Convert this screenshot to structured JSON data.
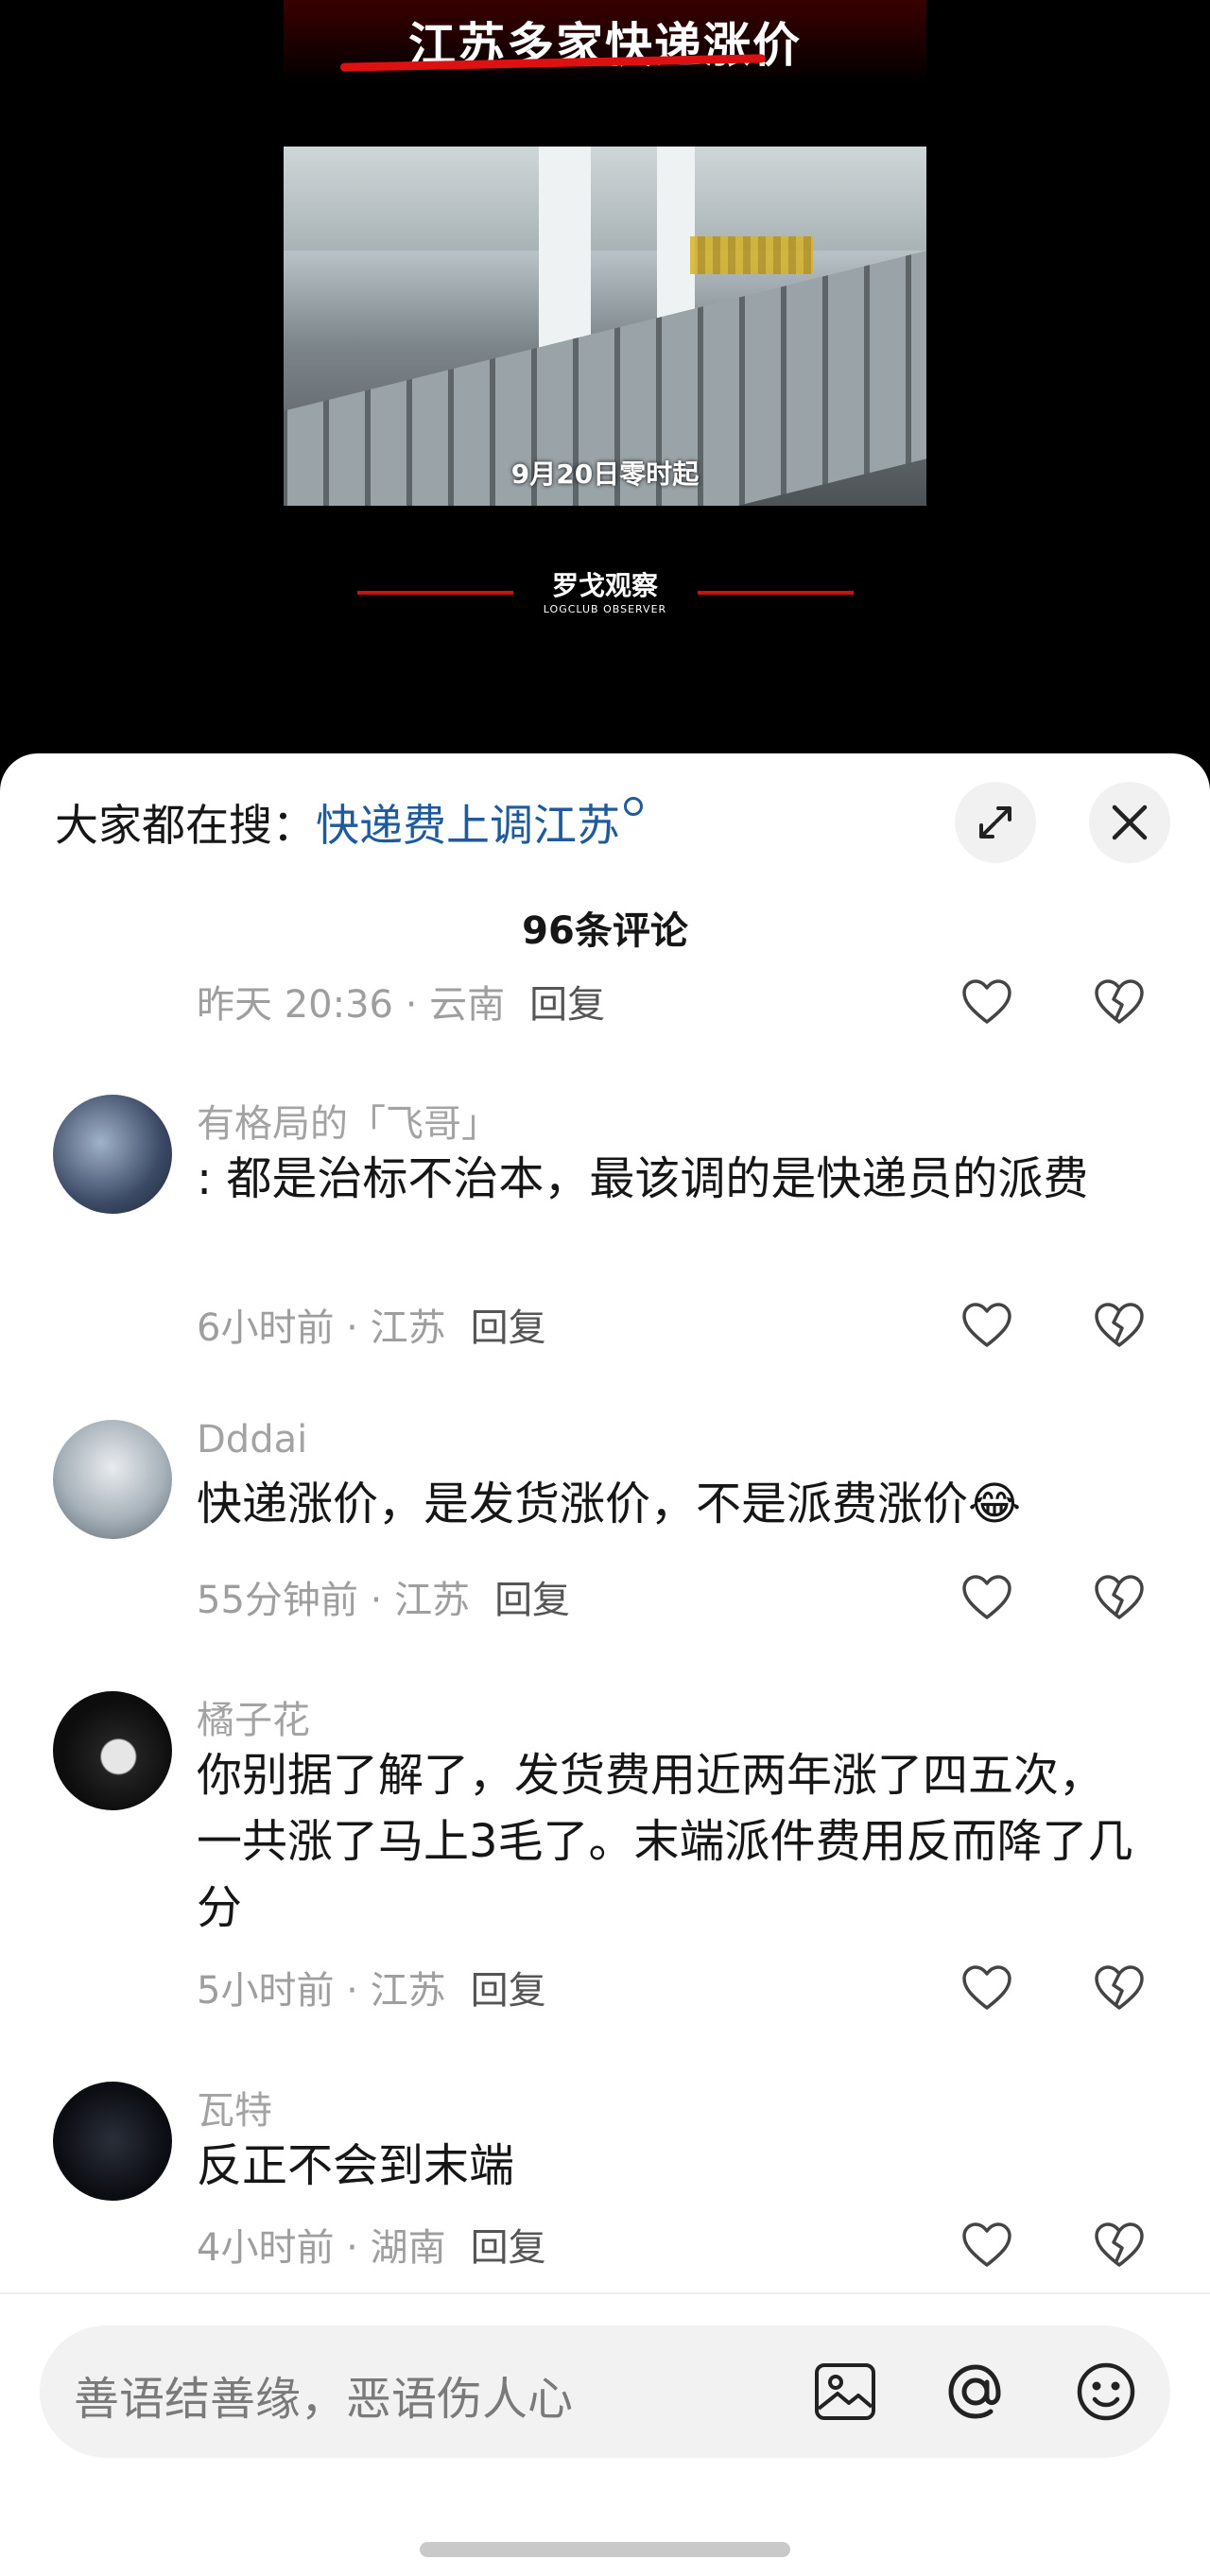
{
  "video": {
    "title": "江苏多家快递涨价",
    "caption": "9月20日零时起",
    "brand_name": "罗戈观察",
    "brand_sub": "LOGCLUB OBSERVER"
  },
  "sheet": {
    "search_label": "大家都在搜：",
    "search_link": "快递费上调江苏",
    "comment_count": "96条评论"
  },
  "comments": [
    {
      "name": "",
      "text": "",
      "time": "昨天 20:36",
      "location": "云南",
      "reply": "回复"
    },
    {
      "name": "有格局的「飞哥」",
      "text": ": 都是治标不治本，最该调的是快递员的派费",
      "time": "6小时前",
      "location": "江苏",
      "reply": "回复"
    },
    {
      "name": "Dddai",
      "text": "快递涨价，是发货涨价，不是派费涨价",
      "emoji": "😂",
      "time": "55分钟前",
      "location": "江苏",
      "reply": "回复"
    },
    {
      "name": "橘子花",
      "text": "你别据了解了，发货费用近两年涨了四五次，一共涨了马上3毛了。末端派件费用反而降了几分",
      "time": "5小时前",
      "location": "江苏",
      "reply": "回复"
    },
    {
      "name": "瓦特",
      "text": "反正不会到末端",
      "time": "4小时前",
      "location": "湖南",
      "reply": "回复"
    }
  ],
  "input": {
    "placeholder": "善语结善缘，恶语伤人心"
  },
  "icons": {
    "expand": "expand-icon",
    "close": "close-icon",
    "like": "heart-icon",
    "dislike": "broken-heart-icon",
    "image": "image-icon",
    "mention": "at-icon",
    "emoji": "smiley-icon"
  }
}
